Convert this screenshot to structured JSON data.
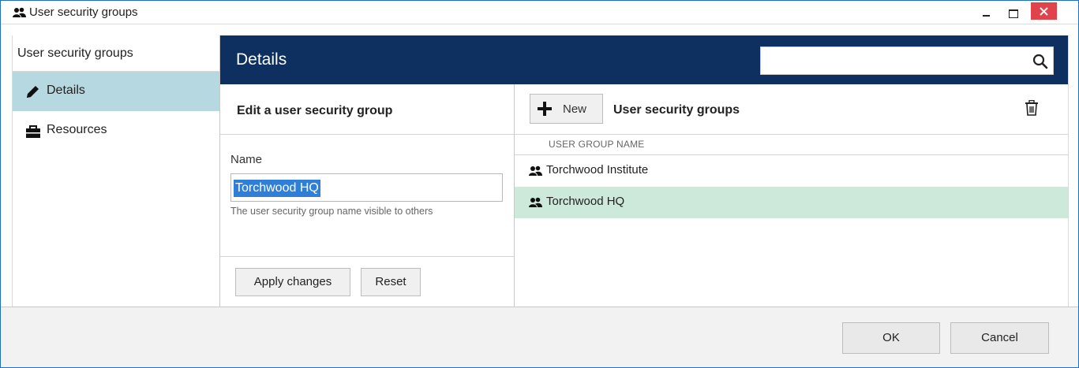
{
  "window": {
    "title": "User security groups",
    "icon": "users-icon"
  },
  "sidebar": {
    "header": "User security groups",
    "items": [
      {
        "label": "Details",
        "icon": "pencil-icon",
        "active": true
      },
      {
        "label": "Resources",
        "icon": "briefcase-icon",
        "active": false
      }
    ]
  },
  "header": {
    "title": "Details",
    "search_value": "",
    "search_icon": "search-icon"
  },
  "edit": {
    "title": "Edit a user security group",
    "name_label": "Name",
    "name_value": "Torchwood HQ",
    "hint": "The user security group name visible to others",
    "apply_label": "Apply changes",
    "reset_label": "Reset"
  },
  "list": {
    "new_label": "New",
    "title": "User security groups",
    "column_header": "USER GROUP NAME",
    "rows": [
      {
        "label": "Torchwood Institute",
        "selected": false
      },
      {
        "label": "Torchwood HQ",
        "selected": true
      }
    ]
  },
  "footer": {
    "ok_label": "OK",
    "cancel_label": "Cancel"
  },
  "colors": {
    "header_bg": "#0d3061",
    "sidebar_active": "#b6d9e1",
    "row_selected": "#cde9d9",
    "close_button": "#e0434b",
    "selection": "#2f7fd9"
  }
}
